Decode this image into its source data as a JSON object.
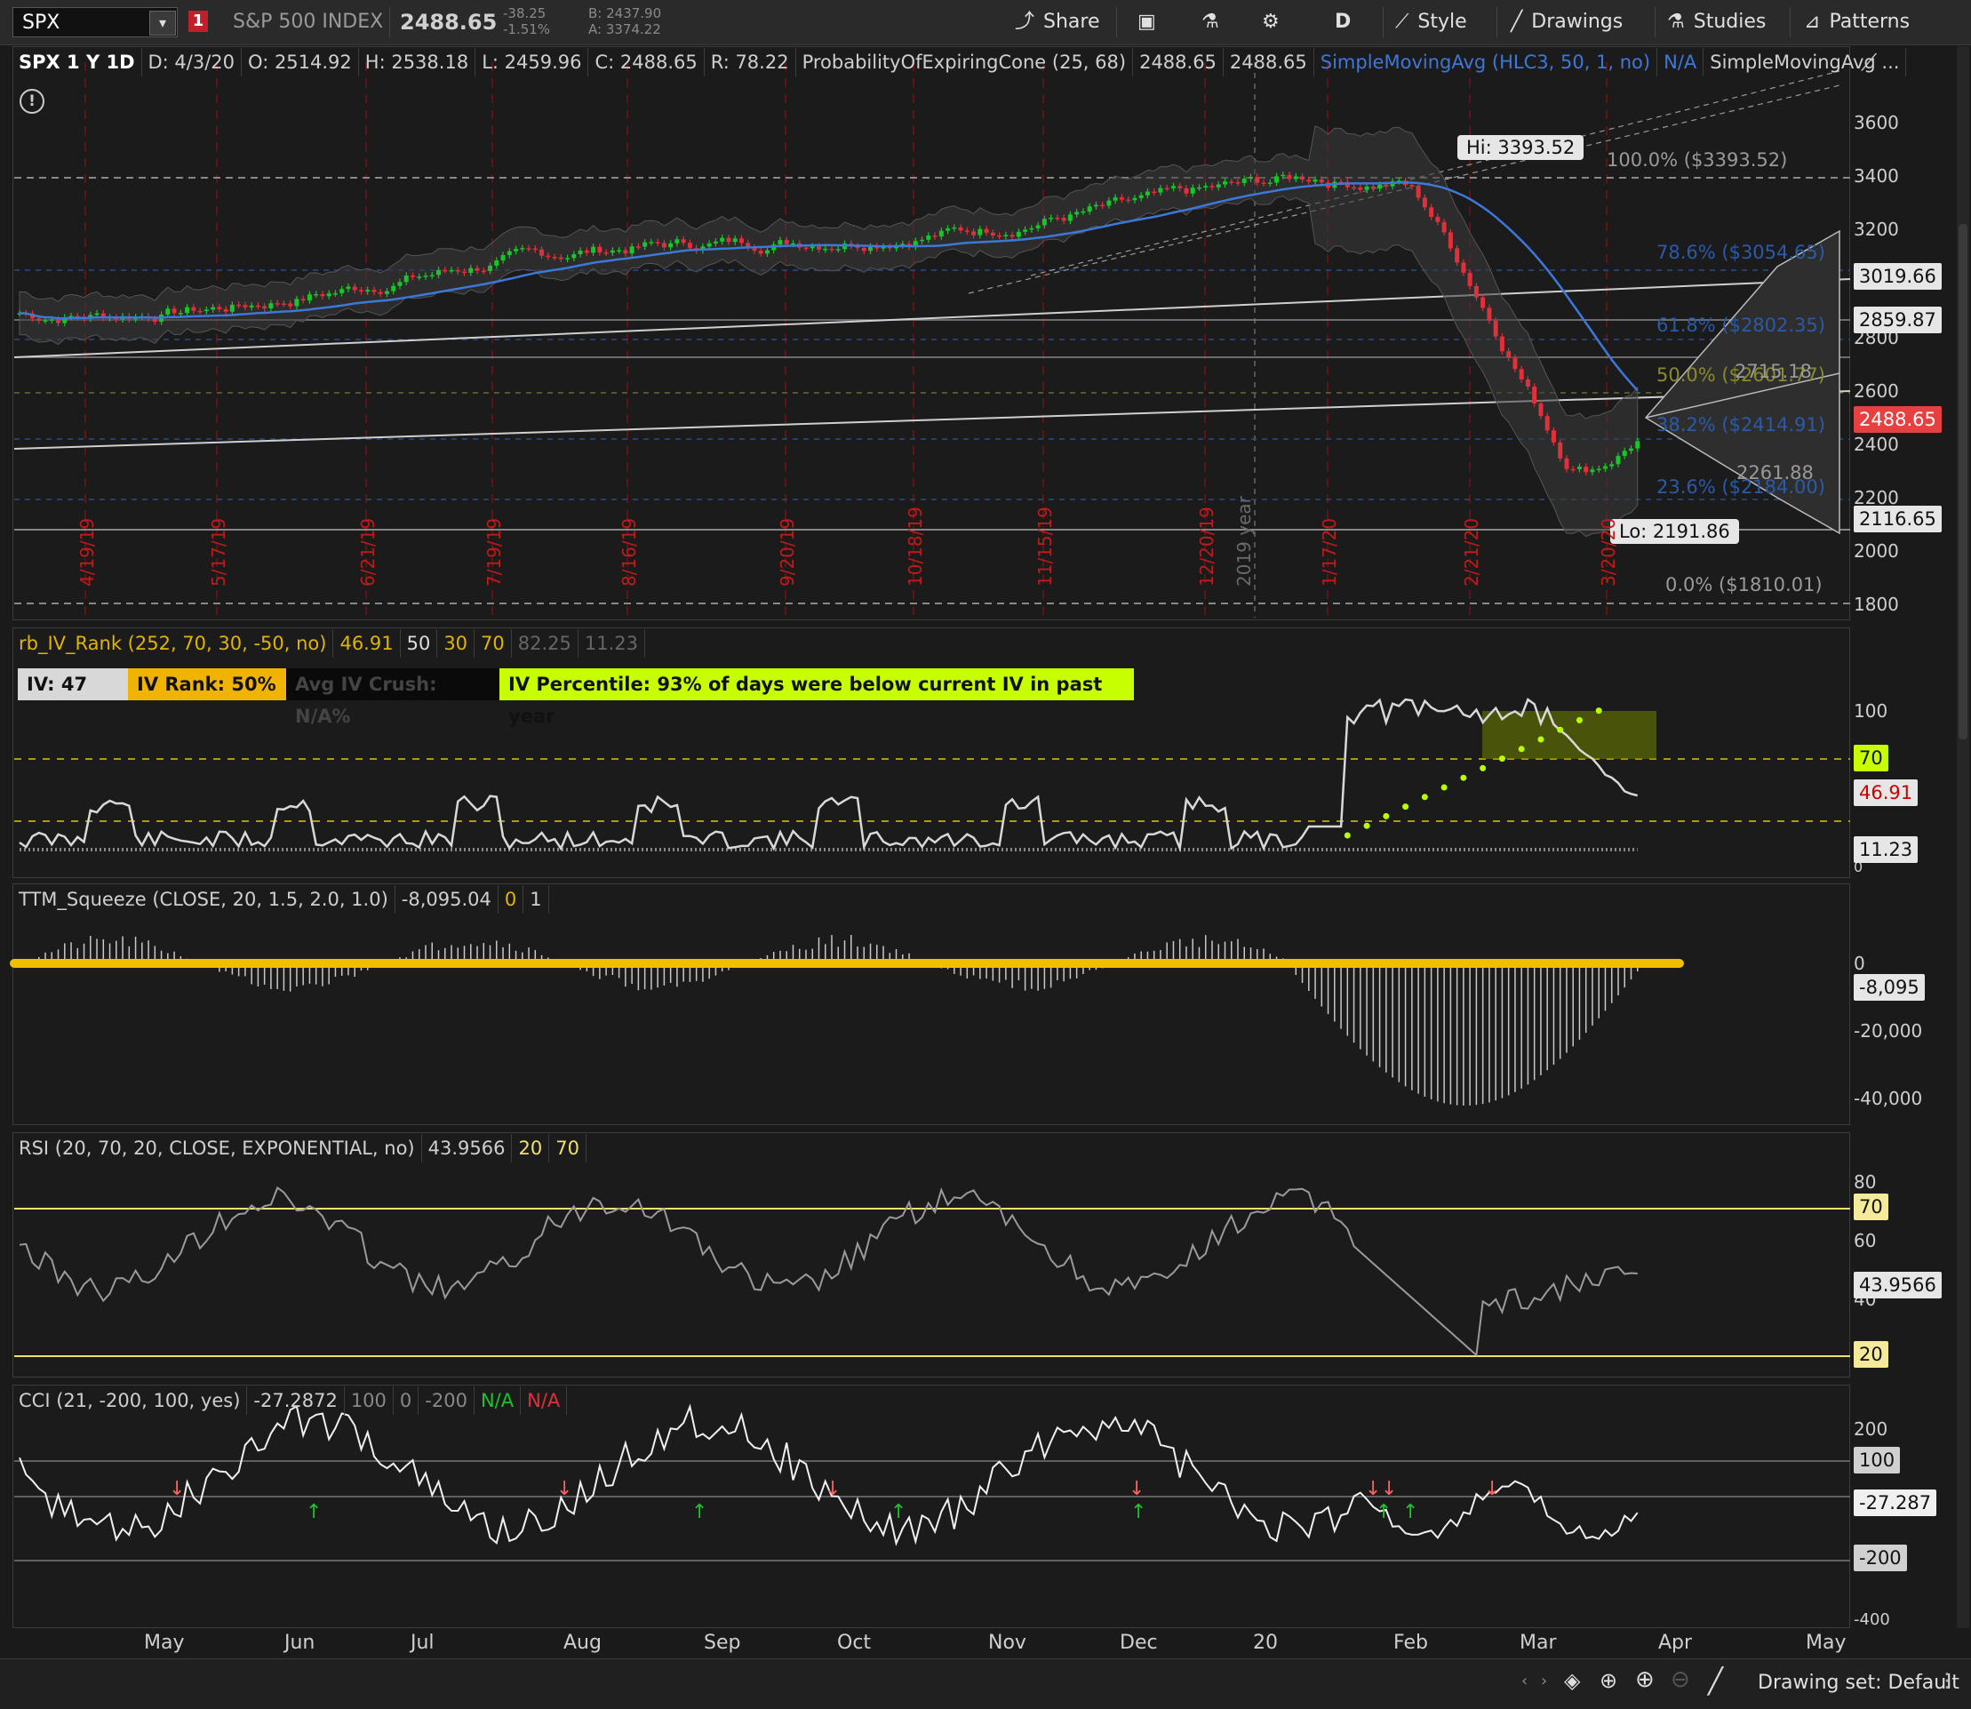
{
  "toolbar": {
    "symbol": "SPX",
    "alert_count": "1",
    "description": "S&P 500 INDEX",
    "last": "2488.65",
    "net_change": "-38.25",
    "pct_change": "-1.51%",
    "bid": "B: 2437.90",
    "ask": "A: 3374.22",
    "share": "Share",
    "aggregation": "D",
    "style": "Style",
    "drawings": "Drawings",
    "studies": "Studies",
    "patterns": "Patterns"
  },
  "price_panel": {
    "header": [
      "SPX 1 Y 1D",
      "D: 4/3/20",
      "O: 2514.92",
      "H: 2538.18",
      "L: 2459.96",
      "C: 2488.65",
      "R: 78.22",
      "ProbabilityOfExpiringCone (25, 68)",
      "2488.65",
      "2488.65",
      "SimpleMovingAvg (HLC3, 50, 1, no)",
      "N/A",
      "SimpleMovingAvg ..."
    ],
    "scale": [
      "3600",
      "3400",
      "3200",
      "2800",
      "2600",
      "2400",
      "2200",
      "2000",
      "1800"
    ],
    "price_tags": [
      "3019.66",
      "2859.87",
      "2488.65",
      "2116.65"
    ],
    "hi_label": "Hi: 3393.52",
    "lo_label": "Lo: 2191.86",
    "fib_100": "100.0%  ($3393.52)",
    "fib_78": "78.6%  ($3054.65)",
    "fib_61": "61.8%  ($2802.35)",
    "fib_50": "50.0%  ($2601.77)",
    "fib_38": "38.2%  ($2414.91)",
    "fib_23": "23.6%  ($2184.00)",
    "fib_0": "0.0%  ($1810.01)",
    "cone_upper": "2715.18",
    "cone_lower": "2261.88",
    "year_marker": "2019 year",
    "date_markers": [
      "4/19/19",
      "5/17/19",
      "6/21/19",
      "7/19/19",
      "8/16/19",
      "9/20/19",
      "10/18/19",
      "11/15/19",
      "12/20/19",
      "1/17/20",
      "2/21/20",
      "3/20/20"
    ],
    "colors": {
      "up": "#19c52a",
      "down": "#e0303a",
      "sma": "#3d78d8"
    }
  },
  "iv_panel": {
    "header": [
      "rb_IV_Rank (252, 70, 30, -50, no)",
      "46.91",
      "50",
      "30",
      "70",
      "82.25",
      "11.23"
    ],
    "iv": "IV: 47",
    "iv_rank": "IV Rank: 50%",
    "avg_crush": "Avg IV Crush: N/A%",
    "iv_percentile": "IV Percentile: 93% of days were below current IV in past year",
    "scale": [
      "100",
      "0"
    ],
    "tags": [
      "70",
      "46.91",
      "11.23"
    ]
  },
  "squeeze_panel": {
    "header": [
      "TTM_Squeeze (CLOSE, 20, 1.5, 2.0, 1.0)",
      "-8,095.04",
      "0",
      "1"
    ],
    "scale": [
      "0",
      "-20,000",
      "-40,000"
    ],
    "tag": "-8,095"
  },
  "rsi_panel": {
    "header": [
      "RSI (20, 70, 20, CLOSE, EXPONENTIAL, no)",
      "43.9566",
      "20",
      "70"
    ],
    "scale": [
      "80",
      "60",
      "40"
    ],
    "tags": [
      "70",
      "43.9566",
      "20"
    ]
  },
  "cci_panel": {
    "header": [
      "CCI (21, -200, 100, yes)",
      "-27.2872",
      "100",
      "0",
      "-200",
      "N/A",
      "N/A"
    ],
    "scale": [
      "200",
      "-400"
    ],
    "tags": [
      "100",
      "-27.287",
      "-200"
    ]
  },
  "x_axis": [
    "May",
    "Jun",
    "Jul",
    "Aug",
    "Sep",
    "Oct",
    "Nov",
    "Dec",
    "20",
    "Feb",
    "Mar",
    "Apr",
    "May"
  ],
  "footer": {
    "drawing_set": "Drawing set: Default"
  }
}
